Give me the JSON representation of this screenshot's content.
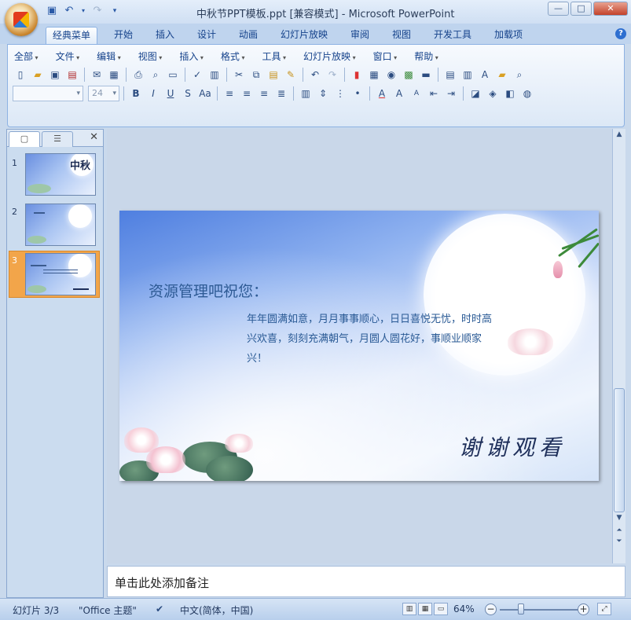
{
  "window": {
    "title": "中秋节PPT模板.ppt [兼容模式] - Microsoft PowerPoint",
    "controls": [
      "—",
      "□",
      "✕"
    ]
  },
  "qat": [
    "save-icon",
    "undo-icon",
    "redo-icon",
    "customize-icon"
  ],
  "tabs": [
    "经典菜单",
    "开始",
    "插入",
    "设计",
    "动画",
    "幻灯片放映",
    "审阅",
    "视图",
    "开发工具",
    "加载项"
  ],
  "menu": [
    "全部",
    "文件",
    "编辑",
    "视图",
    "插入",
    "格式",
    "工具",
    "幻灯片放映",
    "窗口",
    "帮助"
  ],
  "font_size": "24",
  "slides_pane": {
    "thumb1_text": "中秋",
    "numbers": [
      "1",
      "2",
      "3"
    ]
  },
  "slide": {
    "heading": "资源管理吧祝您：",
    "body": "年年圆满如意，月月事事顺心，日日喜悦无忧，时时高兴欢喜，刻刻充满朝气，月圆人圆花好，事顺业顺家兴！",
    "thanks": "谢谢观看"
  },
  "notes": {
    "placeholder": "单击此处添加备注"
  },
  "status": {
    "slide_info": "幻灯片 3/3",
    "theme": "\"Office 主题\"",
    "language": "中文(简体，中国)",
    "zoom": "64%"
  }
}
